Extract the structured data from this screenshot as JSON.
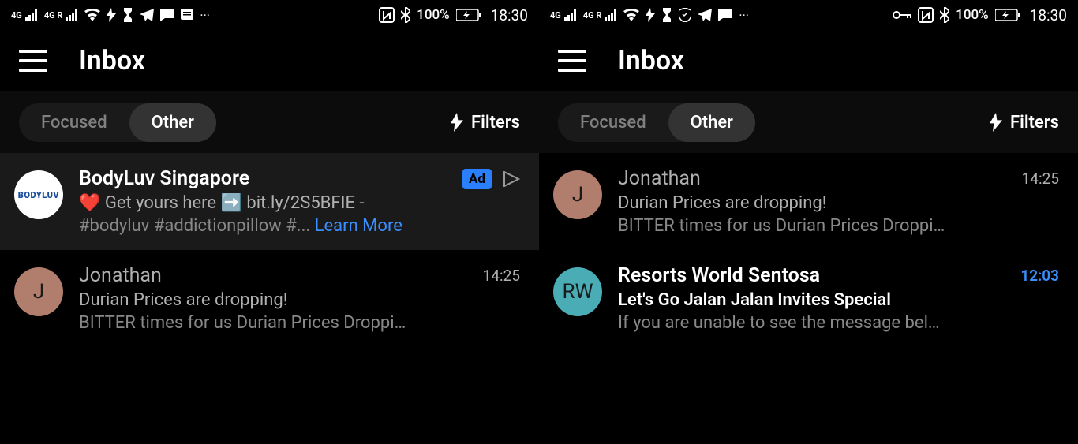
{
  "left": {
    "status": {
      "signal1": "4G",
      "signal2": "4G R",
      "battery": "100%",
      "time": "18:30"
    },
    "header": {
      "title": "Inbox"
    },
    "filter": {
      "tabs": {
        "focused": "Focused",
        "other": "Other"
      },
      "filters_label": "Filters"
    },
    "emails": {
      "ad": {
        "avatar": "BODYLUV",
        "sender": "BodyLuv Singapore",
        "ad_label": "Ad",
        "line1": "❤️ Get yours here ➡️ bit.ly/2S5BFIE  -",
        "line2_a": "#bodyluv #addictionpillow #... ",
        "line2_b": "Learn More"
      },
      "jonathan": {
        "avatar": "J",
        "sender": "Jonathan",
        "time": "14:25",
        "subject": "Durian Prices are dropping!",
        "preview": "BITTER times for us Durian Prices Droppi…"
      }
    }
  },
  "right": {
    "status": {
      "signal1": "4G",
      "signal2": "4G R",
      "battery": "100%",
      "time": "18:30"
    },
    "header": {
      "title": "Inbox"
    },
    "filter": {
      "tabs": {
        "focused": "Focused",
        "other": "Other"
      },
      "filters_label": "Filters"
    },
    "emails": {
      "jonathan": {
        "avatar": "J",
        "sender": "Jonathan",
        "time": "14:25",
        "subject": "Durian Prices are dropping!",
        "preview": "BITTER times for us Durian Prices Droppi…"
      },
      "rws": {
        "avatar": "RW",
        "sender": "Resorts World Sentosa",
        "time": "12:03",
        "subject": "Let's Go Jalan Jalan Invites Special",
        "preview": "If you are unable to see the message bel…"
      }
    }
  }
}
